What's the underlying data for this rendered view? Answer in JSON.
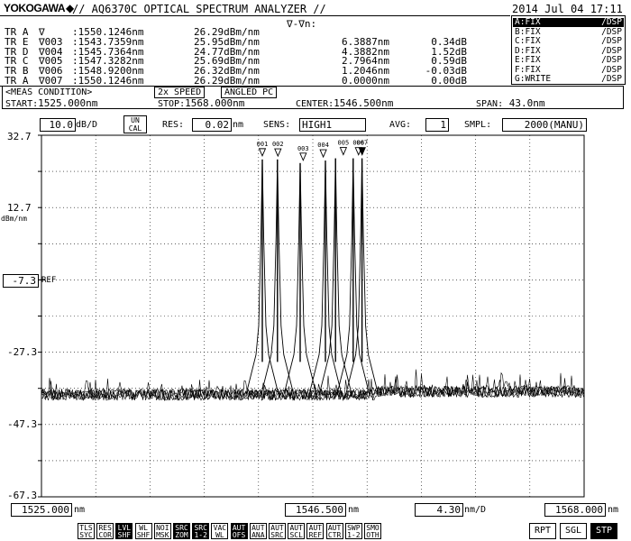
{
  "header": {
    "brand": "YOKOGAWA",
    "brand_symbol": "◆",
    "title": "// AQ6370C OPTICAL SPECTRUM ANALYZER //",
    "datetime": "2014 Jul 04 17:11"
  },
  "markers_table": {
    "delta_header": "∇-∇n:",
    "rows": [
      {
        "trace": "TR A",
        "marker": "∇",
        "wavelength": ":1550.1246nm",
        "level": "26.29dBm/nm",
        "delta_wl": "",
        "delta_lv": ""
      },
      {
        "trace": "TR E",
        "marker": "∇003",
        "wavelength": ":1543.7359nm",
        "level": "25.95dBm/nm",
        "delta_wl": "6.3887nm",
        "delta_lv": "0.34dB"
      },
      {
        "trace": "TR D",
        "marker": "∇004",
        "wavelength": ":1545.7364nm",
        "level": "24.77dBm/nm",
        "delta_wl": "4.3882nm",
        "delta_lv": "1.52dB"
      },
      {
        "trace": "TR C",
        "marker": "∇005",
        "wavelength": ":1547.3282nm",
        "level": "25.69dBm/nm",
        "delta_wl": "2.7964nm",
        "delta_lv": "0.59dB"
      },
      {
        "trace": "TR B",
        "marker": "∇006",
        "wavelength": ":1548.9200nm",
        "level": "26.32dBm/nm",
        "delta_wl": "1.2046nm",
        "delta_lv": "-0.03dB"
      },
      {
        "trace": "TR A",
        "marker": "∇007",
        "wavelength": ":1550.1246nm",
        "level": "26.29dBm/nm",
        "delta_wl": "0.0000nm",
        "delta_lv": "0.00dB"
      }
    ]
  },
  "trace_list": [
    {
      "label": "A:FIX",
      "mode": "/DSP",
      "active": true
    },
    {
      "label": "B:FIX",
      "mode": "/DSP",
      "active": false
    },
    {
      "label": "C:FIX",
      "mode": "/DSP",
      "active": false
    },
    {
      "label": "D:FIX",
      "mode": "/DSP",
      "active": false
    },
    {
      "label": "E:FIX",
      "mode": "/DSP",
      "active": false
    },
    {
      "label": "F:FIX",
      "mode": "/DSP",
      "active": false
    },
    {
      "label": "G:WRITE",
      "mode": "/DSP",
      "active": false
    }
  ],
  "meas_condition": {
    "title": "<MEAS CONDITION>",
    "speed": "2x SPEED",
    "pc": "ANGLED PC",
    "start_label": "START:",
    "start": "1525.000nm",
    "stop_label": "STOP:",
    "stop": "1568.000nm",
    "center_label": "CENTER:",
    "center": "1546.500nm",
    "span_label": "SPAN:",
    "span": "43.0nm"
  },
  "settings_bar": {
    "scale_value": "10.0",
    "scale_unit": "dB/D",
    "uncal_line1": "UN",
    "uncal_line2": "CAL",
    "res_label": "RES:",
    "res_value": "0.02",
    "res_unit": "nm",
    "sens_label": "SENS:",
    "sens_value": "HIGH1",
    "avg_label": "AVG:",
    "avg_value": "1",
    "smpl_label": "SMPL:",
    "smpl_value": "2000(MANU)"
  },
  "y_axis": {
    "unit": "dBm/nm",
    "ref_value": "-7.3",
    "ref_label": "REF",
    "ticks": [
      "32.7",
      "12.7",
      "-27.3",
      "-47.3",
      "-67.3"
    ]
  },
  "x_axis": {
    "start": "1525.000",
    "start_unit": "nm",
    "center": "1546.500",
    "center_unit": "nm",
    "per_div": "4.30",
    "per_div_unit": "nm/D",
    "stop": "1568.000",
    "stop_unit": "nm"
  },
  "chart_data": {
    "type": "line",
    "x_unit": "nm",
    "y_unit": "dBm/nm",
    "xlim": [
      1525.0,
      1568.0
    ],
    "ylim": [
      -67.3,
      32.7
    ],
    "grid": true,
    "noise_floor": -39,
    "markers": [
      {
        "label": "001",
        "wavelength": 1542.5,
        "level": 26.0
      },
      {
        "label": "002",
        "wavelength": 1543.7359,
        "level": 25.95
      },
      {
        "label": "003",
        "wavelength": 1545.7364,
        "level": 24.77
      },
      {
        "label": "004",
        "wavelength": 1547.3282,
        "level": 25.69
      },
      {
        "label": "005",
        "wavelength": 1548.92,
        "level": 26.32
      },
      {
        "label": "006",
        "wavelength": 1550.1246,
        "level": 26.29
      },
      {
        "label": "007",
        "wavelength": 1550.1246,
        "level": 26.29
      }
    ],
    "peaks": [
      {
        "wavelength": 1542.5,
        "level": 26.0
      },
      {
        "wavelength": 1543.7,
        "level": 26.0
      },
      {
        "wavelength": 1545.5,
        "level": 25.0
      },
      {
        "wavelength": 1547.5,
        "level": 25.7
      },
      {
        "wavelength": 1548.3,
        "level": 26.3
      },
      {
        "wavelength": 1549.7,
        "level": 26.3
      },
      {
        "wavelength": 1550.4,
        "level": 26.3
      }
    ]
  },
  "softkeys": [
    {
      "l1": "TLS",
      "l2": "SYC",
      "on": false
    },
    {
      "l1": "RES",
      "l2": "COR",
      "on": false
    },
    {
      "l1": "LVL",
      "l2": "SHF",
      "on": true
    },
    {
      "l1": "WL",
      "l2": "SHF",
      "on": false
    },
    {
      "l1": "NOI",
      "l2": "MSK",
      "on": false
    },
    {
      "l1": "SRC",
      "l2": "ZOM",
      "on": true
    },
    {
      "l1": "SRC",
      "l2": "1-2",
      "on": true
    },
    {
      "l1": "VAC",
      "l2": "WL",
      "on": false
    },
    {
      "l1": "AUT",
      "l2": "OFS",
      "on": true
    },
    {
      "l1": "AUT",
      "l2": "ANA",
      "on": false
    },
    {
      "l1": "AUT",
      "l2": "SRC",
      "on": false
    },
    {
      "l1": "AUT",
      "l2": "SCL",
      "on": false
    },
    {
      "l1": "AUT",
      "l2": "REF",
      "on": false
    },
    {
      "l1": "AUT",
      "l2": "CTR",
      "on": false
    },
    {
      "l1": "SWP",
      "l2": "1-2",
      "on": false
    },
    {
      "l1": "SMO",
      "l2": "OTH",
      "on": false
    }
  ],
  "run_buttons": [
    {
      "label": "RPT",
      "on": false
    },
    {
      "label": "SGL",
      "on": false
    },
    {
      "label": "STP",
      "on": true
    }
  ]
}
